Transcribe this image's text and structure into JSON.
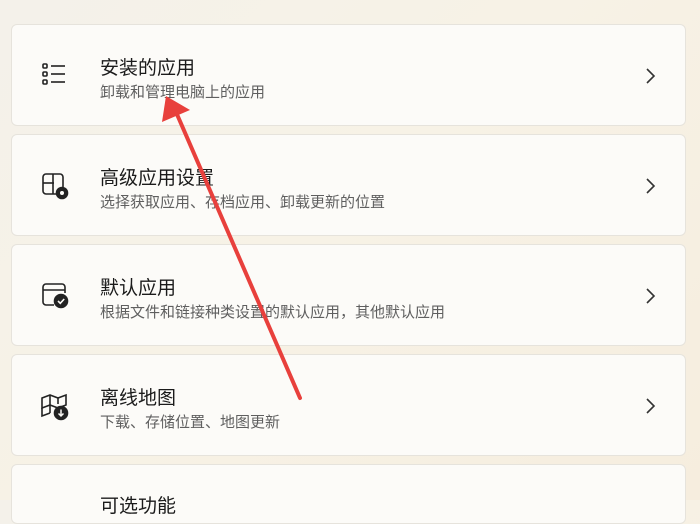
{
  "items": [
    {
      "title": "安装的应用",
      "subtitle": "卸载和管理电脑上的应用",
      "icon": "list-icon"
    },
    {
      "title": "高级应用设置",
      "subtitle": "选择获取应用、存档应用、卸载更新的位置",
      "icon": "app-settings-icon"
    },
    {
      "title": "默认应用",
      "subtitle": "根据文件和链接种类设置的默认应用，其他默认应用",
      "icon": "default-apps-icon"
    },
    {
      "title": "离线地图",
      "subtitle": "下载、存储位置、地图更新",
      "icon": "offline-map-icon"
    },
    {
      "title": "可选功能",
      "subtitle": "",
      "icon": ""
    }
  ],
  "annotation_color": "#e8403c"
}
